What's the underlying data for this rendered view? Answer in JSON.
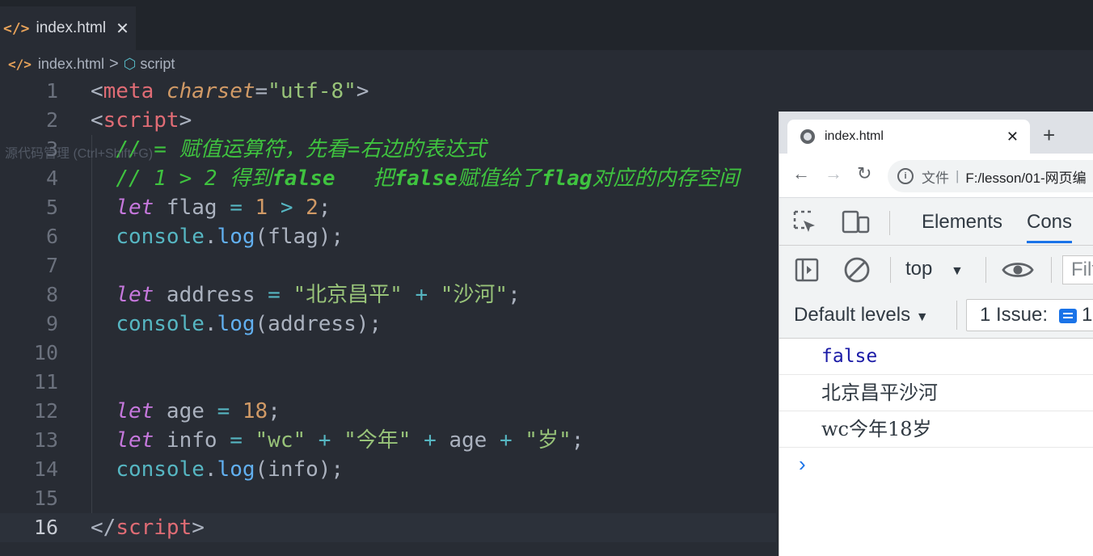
{
  "editor": {
    "tab": {
      "icon": "html-file-icon",
      "label": "index.html",
      "close": "✕"
    },
    "breadcrumb": {
      "file": "index.html",
      "separator": ">",
      "symbol": "script"
    },
    "tooltip": "源代码管理 (Ctrl+Shift+G)",
    "lines": [
      {
        "n": "1"
      },
      {
        "n": "2"
      },
      {
        "n": "3"
      },
      {
        "n": "4"
      },
      {
        "n": "5"
      },
      {
        "n": "6"
      },
      {
        "n": "7"
      },
      {
        "n": "8"
      },
      {
        "n": "9"
      },
      {
        "n": "10"
      },
      {
        "n": "11"
      },
      {
        "n": "12"
      },
      {
        "n": "13"
      },
      {
        "n": "14"
      },
      {
        "n": "15"
      },
      {
        "n": "16"
      }
    ],
    "current_line": "16",
    "code": {
      "l1": {
        "lt": "<",
        "tag": "meta",
        "attr": "charset",
        "eq": "=",
        "val": "\"utf-8\"",
        "gt": ">"
      },
      "l2": {
        "lt": "<",
        "tag": "script",
        "gt": ">"
      },
      "l3": "// = 赋值运算符，先看=右边的表达式",
      "l4a": "// 1 > 2 得到",
      "l4b": "false",
      "l4c": "   把",
      "l4d": "false",
      "l4e": "赋值给了",
      "l4f": "flag",
      "l4g": "对应的内存空间",
      "l5": {
        "kw": "let",
        "name": " flag ",
        "op": "=",
        "a": " 1 ",
        "gt": ">",
        "b": " 2",
        "end": ";"
      },
      "l6": {
        "obj": "console",
        "dot": ".",
        "fn": "log",
        "args": "(flag);"
      },
      "l8": {
        "kw": "let",
        "name": " address ",
        "op": "=",
        "s1": " \"北京昌平\" ",
        "plus": "+",
        "s2": " \"沙河\"",
        "end": ";"
      },
      "l9": {
        "obj": "console",
        "dot": ".",
        "fn": "log",
        "args": "(address);"
      },
      "l12": {
        "kw": "let",
        "name": " age ",
        "op": "=",
        "num": " 18",
        "end": ";"
      },
      "l13": {
        "kw": "let",
        "name": " info ",
        "op": "=",
        "s1": " \"wc\" ",
        "p1": "+",
        "s2": " \"今年\" ",
        "p2": "+",
        "v": " age ",
        "p3": "+",
        "s3": " \"岁\"",
        "end": ";"
      },
      "l14": {
        "obj": "console",
        "dot": ".",
        "fn": "log",
        "args": "(info);"
      },
      "l16": {
        "lt": "</",
        "tag": "script",
        "gt": ">"
      }
    }
  },
  "browser": {
    "tab_title": "index.html",
    "tab_close": "✕",
    "new_tab": "+",
    "nav": {
      "back": "←",
      "forward": "→",
      "reload": "↻"
    },
    "address": {
      "info": "i",
      "scheme": "文件",
      "sep": "|",
      "path": "F:/lesson/01-网页编"
    },
    "devtools": {
      "tabs": [
        "Elements",
        "Cons"
      ],
      "context": "top",
      "filter_placeholder": "Filt",
      "levels": "Default levels",
      "issues_label": "1 Issue:",
      "issues_count": "1"
    },
    "console_output": [
      "false",
      "北京昌平沙河",
      "wc今年18岁"
    ],
    "prompt": "›"
  }
}
